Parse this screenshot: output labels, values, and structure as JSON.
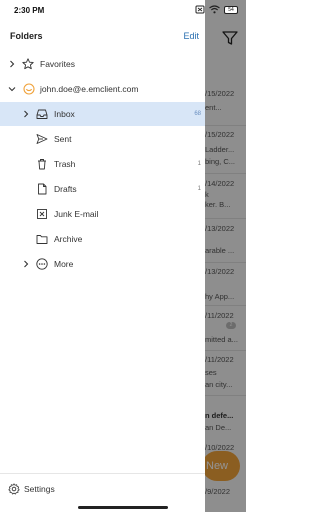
{
  "status_bar": {
    "time": "2:30 PM",
    "battery": "54"
  },
  "drawer": {
    "title": "Folders",
    "edit_label": "Edit",
    "favorites_label": "Favorites",
    "account_email": "john.doe@e.emclient.com",
    "folders": [
      {
        "label": "Inbox",
        "count": "68",
        "selected": true
      },
      {
        "label": "Sent",
        "count": ""
      },
      {
        "label": "Trash",
        "count": "1"
      },
      {
        "label": "Drafts",
        "count": "1"
      },
      {
        "label": "Junk E-mail",
        "count": ""
      },
      {
        "label": "Archive",
        "count": ""
      },
      {
        "label": "More",
        "count": ""
      }
    ],
    "settings_label": "Settings"
  },
  "background_list": {
    "new_button_label": "New",
    "rows": [
      "/15/2022",
      "ent...",
      "/15/2022",
      "Ladder...",
      "bing, C...",
      "/14/2022",
      "k",
      "ker. B...",
      "/13/2022",
      "arable ...",
      "/13/2022",
      "hy App...",
      "/11/2022",
      "mitted a...",
      "/11/2022",
      "ses",
      "an city...",
      "n defe...",
      "an De...",
      "/10/2022",
      "/9/2022"
    ],
    "badges": [
      "2",
      "2"
    ]
  },
  "colors": {
    "accent": "#2a6fb0",
    "selected_bg": "#d8e6f7",
    "new_button": "#f0a23a"
  }
}
